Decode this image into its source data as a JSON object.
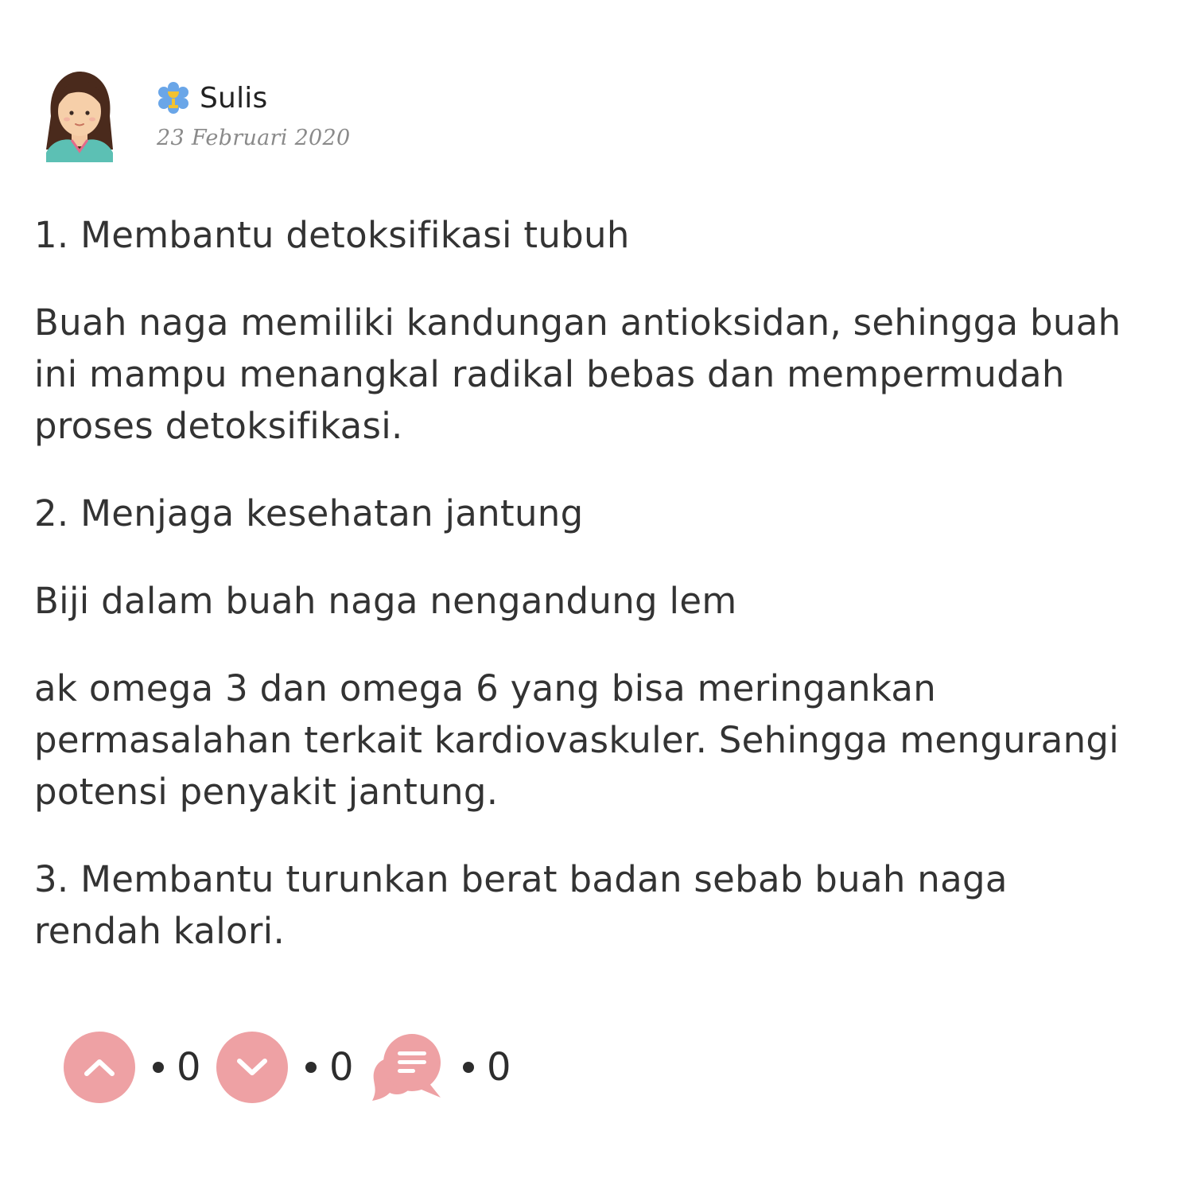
{
  "post": {
    "author": {
      "name": "Sulis",
      "date": "23 Februari 2020",
      "avatar_icon": "female-avatar-icon",
      "badge_icon": "user-level-badge-icon"
    },
    "paragraphs": [
      "1. Membantu detoksifikasi tubuh",
      "Buah naga memiliki kandungan antioksidan, sehingga buah\nini mampu menangkal radikal bebas dan mempermudah\nproses detoksifikasi.",
      "2. Menjaga kesehatan jantung",
      "Biji dalam buah naga nengandung lem",
      "ak omega 3 dan omega 6 yang bisa meringankan\npermasalahan terkait kardiovaskuler. Sehingga mengurangi\npotensi penyakit jantung.",
      "3. Membantu turunkan berat badan sebab buah naga\nrendah kalori."
    ],
    "actions": {
      "upvote": {
        "icon": "chevron-up-icon",
        "count": "0"
      },
      "downvote": {
        "icon": "chevron-down-icon",
        "count": "0"
      },
      "comment": {
        "icon": "comment-bubble-icon",
        "count": "0"
      }
    }
  },
  "colors": {
    "action_pink": "#eea1a4",
    "text": "#333333",
    "date": "#8a8a8a",
    "badge_blue": "#6aa6e8",
    "badge_gold": "#f2c230"
  }
}
